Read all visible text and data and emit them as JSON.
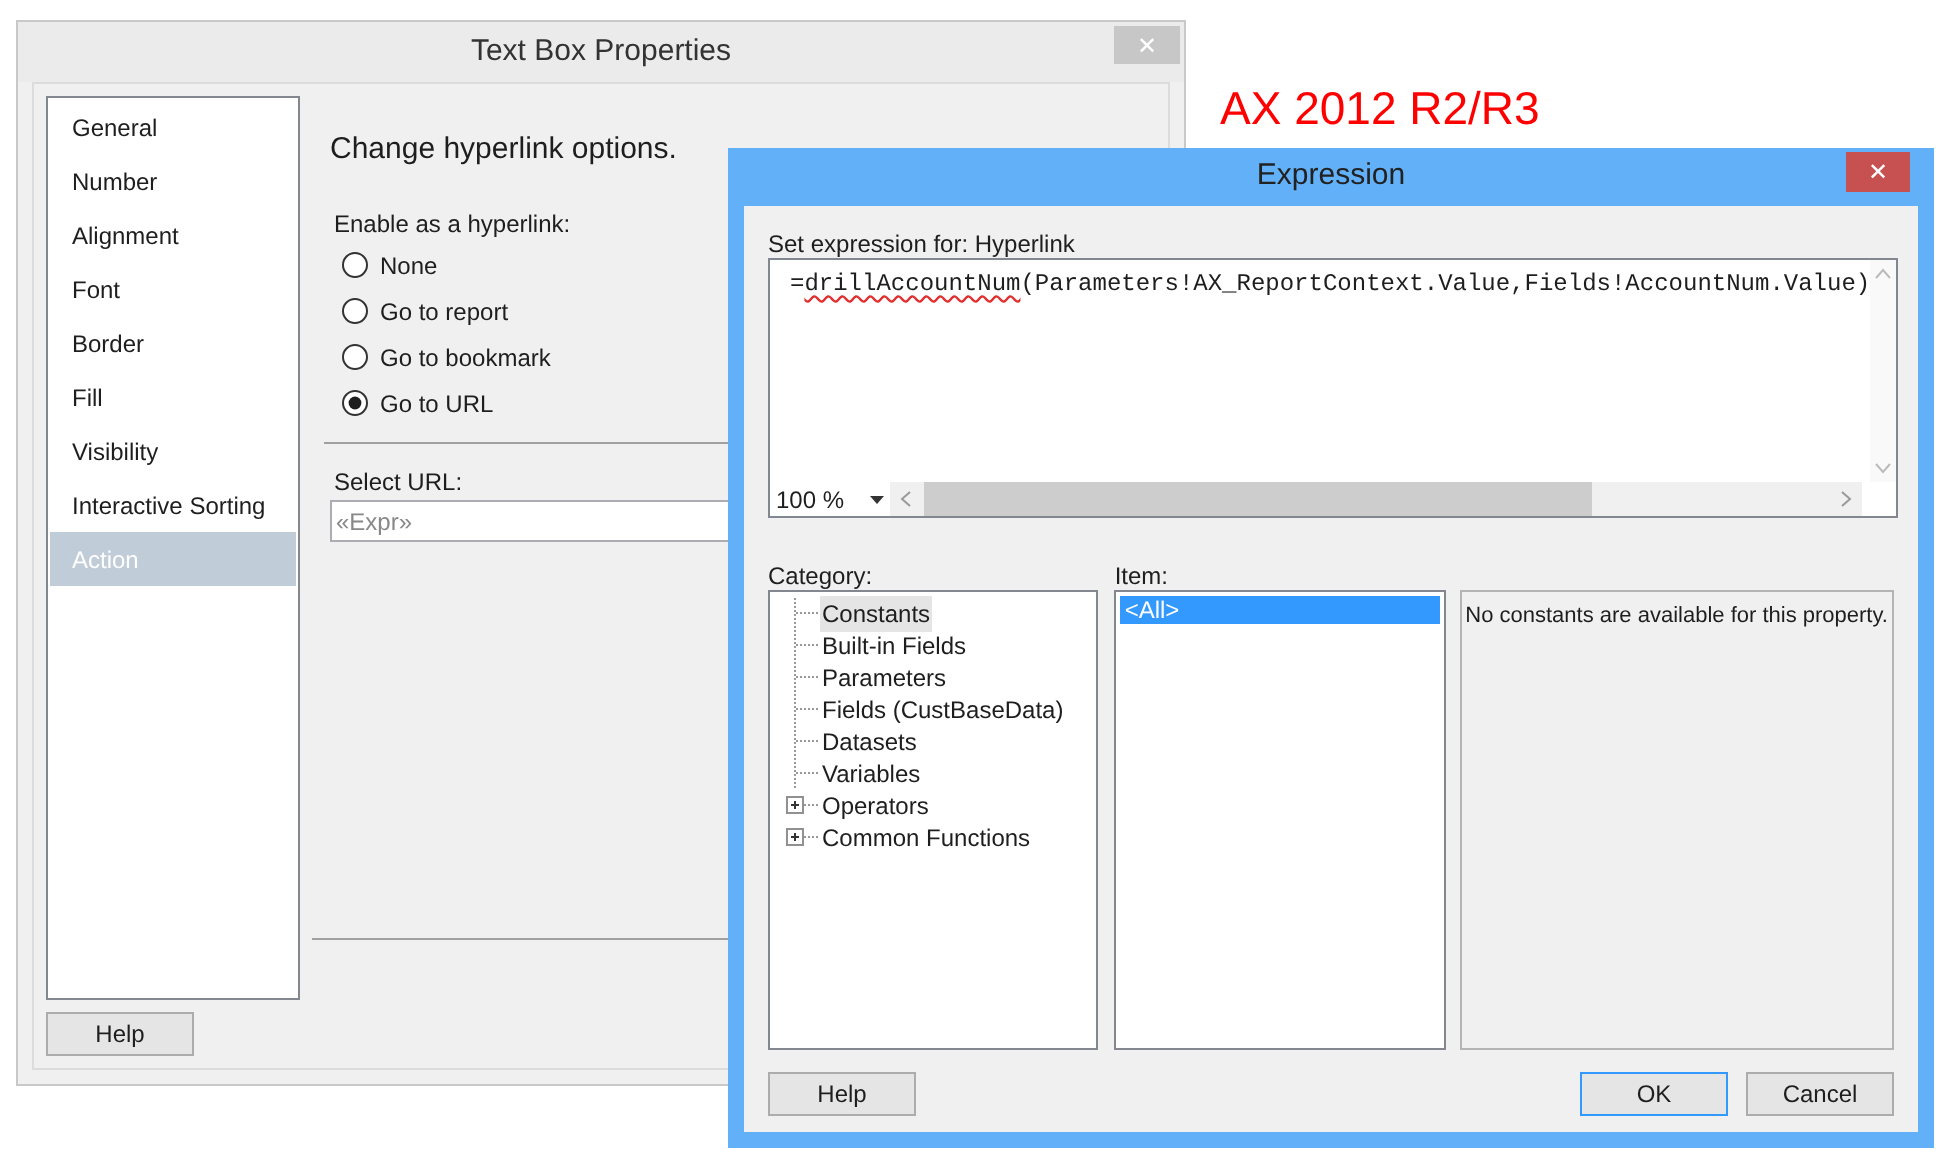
{
  "background_dialog": {
    "title": "Text Box Properties",
    "close": "✕",
    "sidebar": {
      "items": [
        {
          "label": "General",
          "selected": false
        },
        {
          "label": "Number",
          "selected": false
        },
        {
          "label": "Alignment",
          "selected": false
        },
        {
          "label": "Font",
          "selected": false
        },
        {
          "label": "Border",
          "selected": false
        },
        {
          "label": "Fill",
          "selected": false
        },
        {
          "label": "Visibility",
          "selected": false
        },
        {
          "label": "Interactive Sorting",
          "selected": false
        },
        {
          "label": "Action",
          "selected": true
        }
      ]
    },
    "heading": "Change hyperlink options.",
    "hyperlink_group": {
      "label": "Enable as a hyperlink:",
      "options": [
        {
          "label": "None",
          "selected": false
        },
        {
          "label": "Go to report",
          "selected": false
        },
        {
          "label": "Go to bookmark",
          "selected": false
        },
        {
          "label": "Go to URL",
          "selected": true
        }
      ]
    },
    "url": {
      "label": "Select URL:",
      "value": "«Expr»"
    },
    "help_button": "Help"
  },
  "annotation": "AX 2012 R2/R3",
  "expression_dialog": {
    "title": "Expression",
    "close": "✕",
    "expression_label": "Set expression for: Hyperlink",
    "expression": [
      {
        "text": "=",
        "misspelled": false
      },
      {
        "text": "drillAccountNum",
        "misspelled": true
      },
      {
        "text": "(Parameters!AX_ReportContext.Value,Fields!AccountNum.Value)",
        "misspelled": false
      }
    ],
    "zoom": "100 %",
    "category": {
      "label": "Category:",
      "items": [
        {
          "label": "Constants",
          "kind": "leaf",
          "selected": true
        },
        {
          "label": "Built-in Fields",
          "kind": "leaf",
          "selected": false
        },
        {
          "label": "Parameters",
          "kind": "leaf",
          "selected": false
        },
        {
          "label": "Fields (CustBaseData)",
          "kind": "leaf",
          "selected": false
        },
        {
          "label": "Datasets",
          "kind": "leaf",
          "selected": false
        },
        {
          "label": "Variables",
          "kind": "leaf",
          "selected": false
        },
        {
          "label": "Operators",
          "kind": "group",
          "expanded": false,
          "selected": false
        },
        {
          "label": "Common Functions",
          "kind": "group",
          "expanded": false,
          "selected": false
        }
      ]
    },
    "item": {
      "label": "Item:",
      "items": [
        {
          "label": "<All>",
          "selected": true
        }
      ]
    },
    "description": "No constants are available for this property.",
    "buttons": [
      {
        "label": "Help",
        "default": false
      },
      {
        "label": "OK",
        "default": true
      },
      {
        "label": "Cancel",
        "default": false
      }
    ]
  }
}
